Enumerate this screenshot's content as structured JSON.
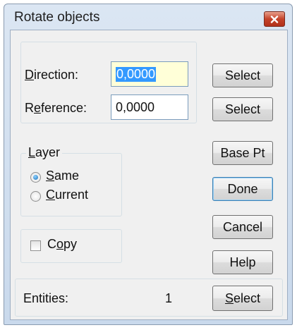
{
  "window": {
    "title": "Rotate objects",
    "close_icon": "close-icon"
  },
  "direction": {
    "label_ul": "D",
    "label_rest": "irection:",
    "value": "0,0000",
    "button": "Select"
  },
  "reference": {
    "label_pre": "R",
    "label_ul": "e",
    "label_rest": "ference:",
    "value": "0,0000",
    "button": "Select"
  },
  "layer": {
    "legend_ul": "L",
    "legend_rest": "ayer",
    "options": [
      {
        "ul": "S",
        "rest": "ame",
        "selected": true
      },
      {
        "ul": "C",
        "rest": "urrent",
        "selected": false
      }
    ]
  },
  "copy": {
    "label_pre": "C",
    "label_ul": "o",
    "label_rest": "py",
    "checked": false
  },
  "buttons": {
    "base_pt": "Base Pt",
    "done": "Done",
    "cancel": "Cancel",
    "help": "Help"
  },
  "entities": {
    "label": "Entities:",
    "count": "1",
    "button_ul": "S",
    "button_rest": "elect"
  },
  "colors": {
    "title_bg": "#c9d9ec",
    "close_button": "#c4432a",
    "selection": "#3399ff",
    "active_field_bg": "#ffffd8"
  }
}
